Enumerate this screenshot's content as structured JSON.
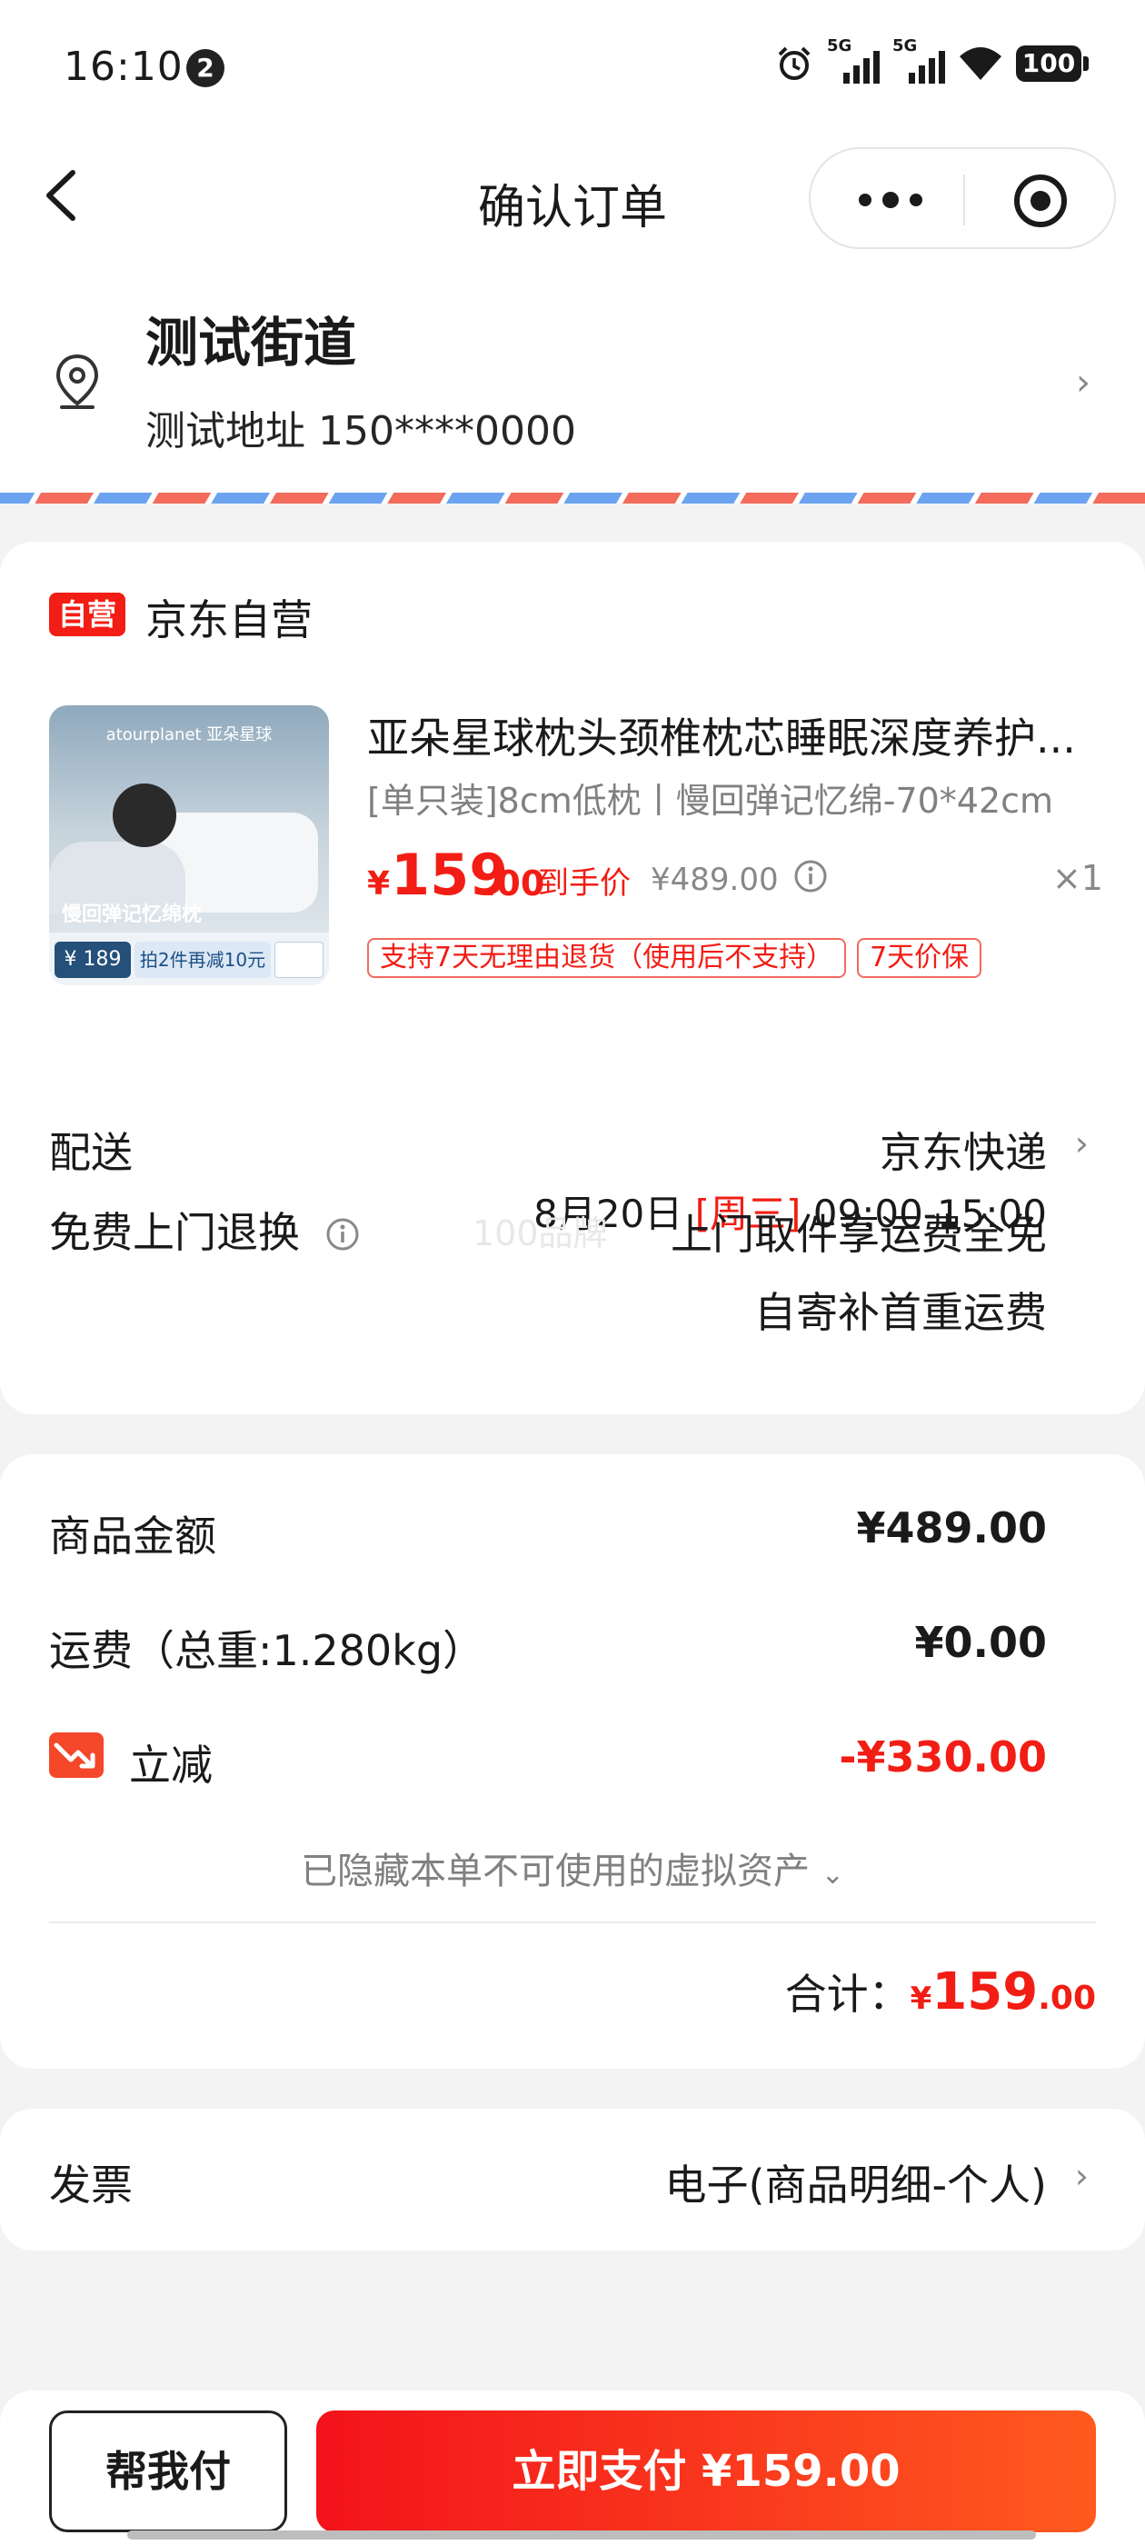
{
  "status_bar": {
    "time": "16:10",
    "notification_count": "2",
    "signal1": "5G",
    "signal2": "5G",
    "battery": "100"
  },
  "nav": {
    "title": "确认订单"
  },
  "address": {
    "title": "测试街道",
    "detail": "测试地址 150****0000"
  },
  "store": {
    "tag": "自营",
    "name": "京东自营"
  },
  "product": {
    "image_brand": "atourplanet 亚朵星球",
    "image_caption": "慢回弹记忆绵枕",
    "image_price": "¥ 189",
    "image_promo": "拍2件再减10元",
    "title": "亚朵星球枕头颈椎枕芯睡眠深度养护...",
    "spec": "[单只装]8cm低枕丨慢回弹记忆绵-70*42cm",
    "price_yen": "¥",
    "price_int": "159",
    "price_dec": ".00",
    "price_tag": "到手价",
    "original_price": "¥489.00",
    "quantity": "×1",
    "badges": [
      "支持7天无理由退货（使用后不支持）",
      "7天价保"
    ]
  },
  "delivery": {
    "label": "配送",
    "carrier": "京东快递",
    "date": "8月20日",
    "weekday": "[周三]",
    "time_window": "09:00-15:00"
  },
  "returns": {
    "label": "免费上门退换",
    "watermark": "100品牌",
    "line1": "上门取件享运费全免",
    "line2": "自寄补首重运费"
  },
  "summary": {
    "goods_label": "商品金额",
    "goods_value": "¥489.00",
    "shipping_label": "运费（总重:1.280kg）",
    "shipping_value": "¥0.00",
    "discount_label": "立减",
    "discount_value": "-¥330.00",
    "hidden_assets": "已隐藏本单不可使用的虚拟资产",
    "total_label": "合计：",
    "total_yen": "¥",
    "total_int": "159",
    "total_dec": ".00"
  },
  "invoice": {
    "label": "发票",
    "value": "电子(商品明细-个人)"
  },
  "footer": {
    "help_pay": "帮我付",
    "pay_now": "立即支付 ¥159.00"
  },
  "colors": {
    "accent_red": "#f21d14",
    "pay_gradient_end": "#ff5a1f",
    "background": "#f3f3f3"
  }
}
